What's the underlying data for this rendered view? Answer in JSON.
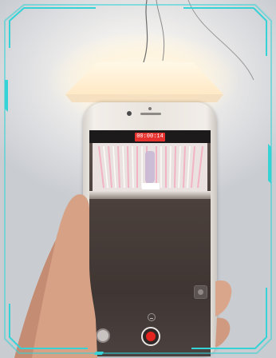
{
  "phone": {
    "recording_timer": "00:00:14"
  },
  "colors": {
    "frame_accent": "#35d3d6",
    "record_red": "#e4251f",
    "timer_badge": "#e6322e"
  },
  "icons": {
    "zoom": "square-camera-switch-icon",
    "mini": "flip-camera-icon",
    "left_control": "capture-mode-icon",
    "record": "record-button-icon"
  }
}
